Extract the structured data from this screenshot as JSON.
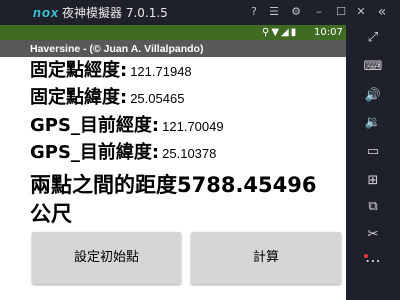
{
  "window": {
    "logo": "nox",
    "title": "夜神模擬器 7.0.1.5",
    "controls": [
      "?",
      "☰",
      "⚙",
      "–",
      "☐",
      "✕",
      "«"
    ]
  },
  "status_bar": {
    "icons": "⚲▼◢▮",
    "time": "10:07"
  },
  "app_bar": {
    "title": "Haversine - (© Juan A. Villalpando)"
  },
  "fields": {
    "fixed_lon_label": "固定點經度:",
    "fixed_lon_value": "121.71948",
    "fixed_lat_label": "固定點緯度:",
    "fixed_lat_value": "25.05465",
    "gps_lon_label": "GPS_目前經度:",
    "gps_lon_value": "121.70049",
    "gps_lat_label": "GPS_目前緯度:",
    "gps_lat_value": "25.10378"
  },
  "distance": {
    "line1": "兩點之間的距度5788.45496",
    "line2": "公尺"
  },
  "buttons": {
    "set_initial": "設定初始點",
    "calculate": "計算"
  },
  "sidebar": {
    "icons": [
      "⤢",
      "⌨",
      "🔊",
      "🔉",
      "▭",
      "⊞",
      "⧉",
      "✂",
      "⋯"
    ]
  }
}
